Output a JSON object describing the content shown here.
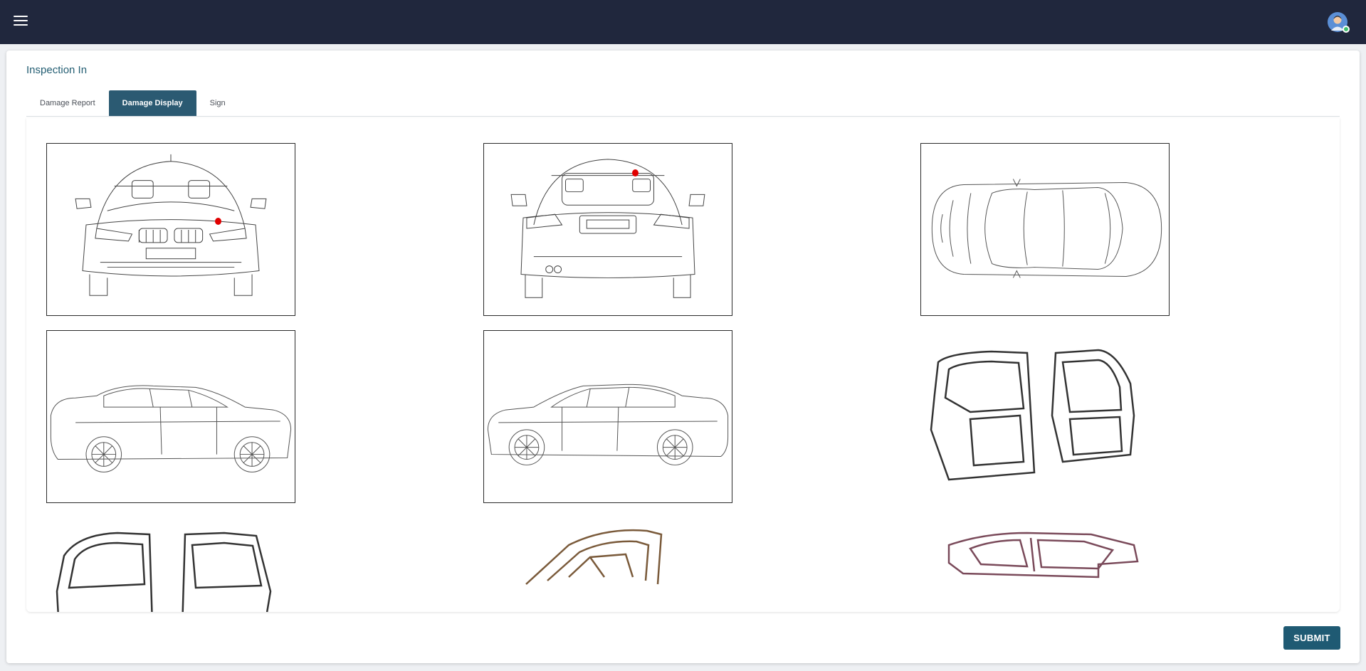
{
  "header": {
    "menu_icon": "hamburger-menu-icon",
    "avatar_icon": "user-avatar-icon"
  },
  "page": {
    "title": "Inspection In"
  },
  "tabs": [
    {
      "label": "Damage Report",
      "active": false
    },
    {
      "label": "Damage Display",
      "active": true
    },
    {
      "label": "Sign",
      "active": false
    }
  ],
  "diagrams": [
    {
      "view": "front",
      "damage_marks": 1
    },
    {
      "view": "rear",
      "damage_marks": 1
    },
    {
      "view": "top",
      "damage_marks": 0
    },
    {
      "view": "left-side",
      "damage_marks": 0
    },
    {
      "view": "right-side",
      "damage_marks": 0
    },
    {
      "view": "right-doors",
      "damage_marks": 0
    },
    {
      "view": "left-doors",
      "damage_marks": 0
    },
    {
      "view": "trunk-lid",
      "damage_marks": 0
    },
    {
      "view": "side-frame",
      "damage_marks": 0
    }
  ],
  "colors": {
    "topbar": "#20273d",
    "accent": "#2b5a72",
    "damage_marker": "#e00000"
  },
  "actions": {
    "submit_label": "SUBMIT"
  }
}
